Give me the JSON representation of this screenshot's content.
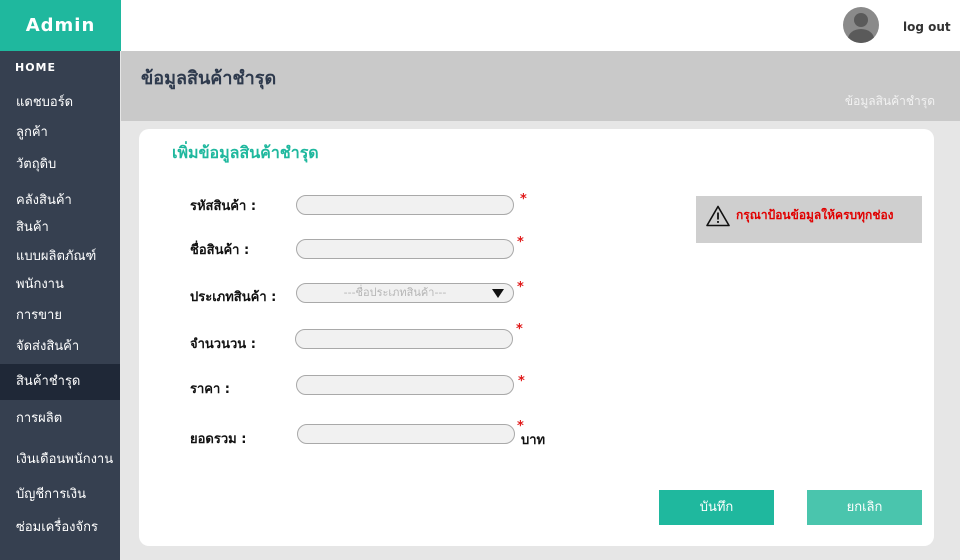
{
  "brand": "Admin",
  "topbar": {
    "logout_label": "log out"
  },
  "sidebar": {
    "home_label": "HOME",
    "items": [
      {
        "label": "แดชบอร์ด"
      },
      {
        "label": "ลูกค้า"
      },
      {
        "label": "วัตถุดิบ"
      },
      {
        "label": "คลังสินค้า"
      },
      {
        "label": "สินค้า"
      },
      {
        "label": "แบบผลิตภัณฑ์"
      },
      {
        "label": "พนักงาน"
      },
      {
        "label": "การขาย"
      },
      {
        "label": "จัดส่งสินค้า"
      },
      {
        "label": "สินค้าชำรุด",
        "active": true
      },
      {
        "label": "การผลิต"
      },
      {
        "label": "เงินเดือนพนักงาน"
      },
      {
        "label": "บัญชีการเงิน"
      },
      {
        "label": "ซ่อมเครื่องจักร"
      }
    ]
  },
  "page": {
    "title": "ข้อมูลสินค้าชำรุด",
    "breadcrumb": "ข้อมูลสินค้าชำรุด"
  },
  "form": {
    "title": "เพิ่มข้อมูลสินค้าชำรุด",
    "fields": {
      "product_code": {
        "label": "รหัสสินค้า :",
        "value": ""
      },
      "product_name": {
        "label": "ชื่อสินค้า :",
        "value": ""
      },
      "product_type": {
        "label": "ประเภทสินค้า :",
        "placeholder": "---ชื่อประเภทสินค้า---"
      },
      "quantity": {
        "label": "จำนวนวน :",
        "value": ""
      },
      "price": {
        "label": "ราคา :",
        "value": ""
      },
      "total": {
        "label": "ยอดรวม :",
        "value": "",
        "unit": "บาท"
      }
    },
    "required_mark": "*"
  },
  "alert": {
    "message": "กรุณาป้อนข้อมูลให้ครบทุกช่อง",
    "icon": "warning-icon"
  },
  "buttons": {
    "save_label": "บันทึก",
    "cancel_label": "ยกเลิก"
  },
  "colors": {
    "accent": "#1fb89e",
    "sidebar": "#364050",
    "alert_text": "#e00000"
  }
}
